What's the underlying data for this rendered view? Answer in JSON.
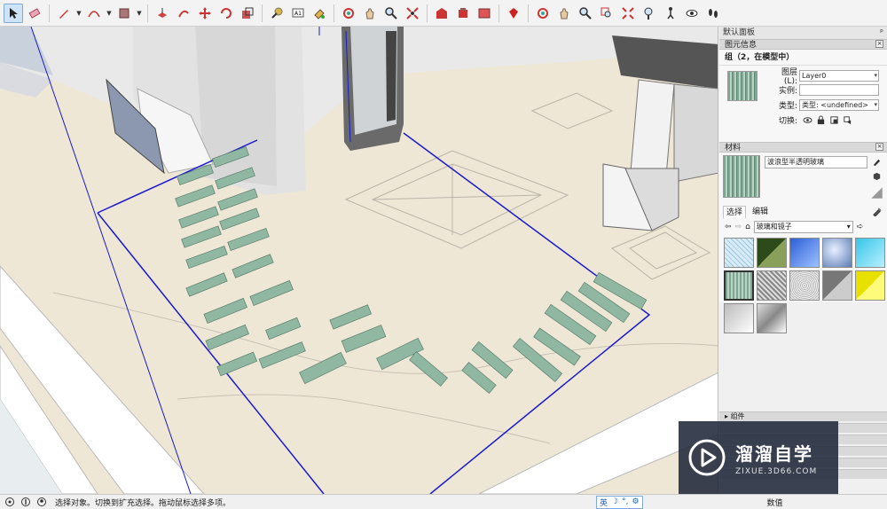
{
  "toolbar": {
    "icons": [
      "select-icon",
      "eraser-icon",
      "pencil-icon",
      "arc-icon",
      "shape-icon",
      "pushpull-icon",
      "followme-icon",
      "move-icon",
      "rotate-icon",
      "scale-icon",
      "tape-icon",
      "text-icon",
      "paint-icon",
      "orbit-icon",
      "pan-icon",
      "zoom-icon",
      "zoom-extents-icon",
      "warehouse-icon",
      "extension-icon",
      "share-icon",
      "ruby-icon",
      "orbit2-icon",
      "pan2-icon",
      "zoom2-icon",
      "zoomwindow-icon",
      "zoomextents2-icon",
      "position-camera-icon",
      "walk-icon",
      "lookaround-icon",
      "footprints-icon"
    ]
  },
  "tray": {
    "title": "默认面板",
    "pin": "ᵖ",
    "entity_info": {
      "header": "图元信息",
      "title": "组（2，在模型中）",
      "layer_label": "图层(L):",
      "layer_value": "Layer0",
      "instance_label": "实例:",
      "instance_value": "",
      "type_label": "类型:",
      "type_value": "类型: <undefined>",
      "toggle_label": "切换:"
    },
    "materials": {
      "header": "材料",
      "name_value": "波浪型半透明玻璃",
      "tab_select": "选择",
      "tab_edit": "编辑",
      "library": "玻璃和镜子"
    },
    "components_header": "组件"
  },
  "status": {
    "message": "选择对象。切换到扩充选择。拖动鼠标选择多项。",
    "ime_lang": "英",
    "measurements_label": "数值"
  },
  "watermark": {
    "main": "溜溜自学",
    "sub": "ZIXUE.3D66.COM"
  },
  "colors": {
    "selection_blue": "#1a1acc",
    "floor": "#efe7d6",
    "wall": "#e8e8e8",
    "glass": "#8fb7a2"
  }
}
